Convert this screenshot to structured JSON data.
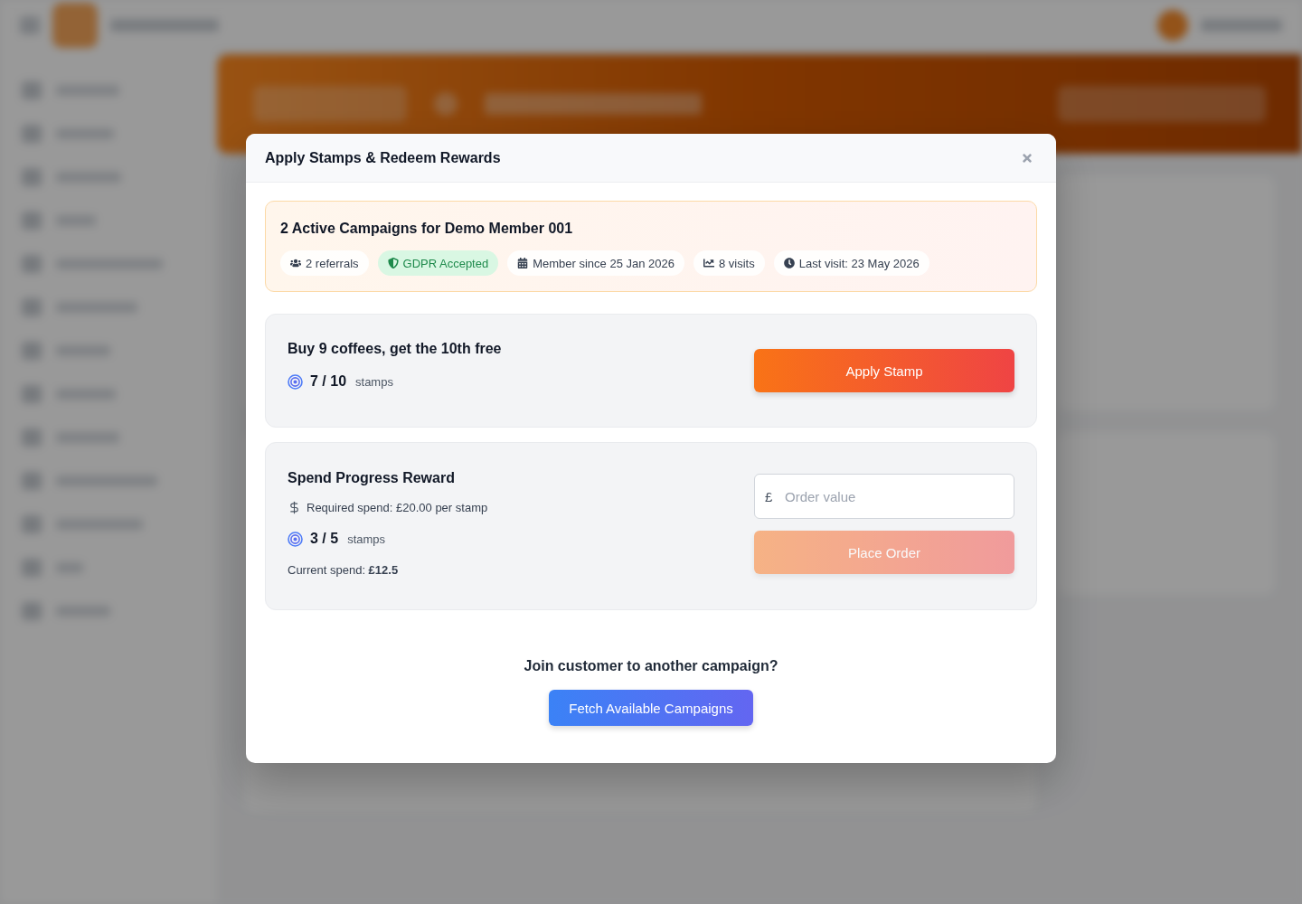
{
  "modal": {
    "title": "Apply Stamps & Redeem Rewards",
    "summary": {
      "title": "2 Active Campaigns for Demo Member 001",
      "chips": [
        {
          "kind": "referrals",
          "label": "2 referrals"
        },
        {
          "kind": "consent",
          "label": "GDPR Accepted"
        },
        {
          "kind": "member_since",
          "label": "Member since 25 Jan 2026"
        },
        {
          "kind": "visits",
          "label": "8 visits"
        },
        {
          "kind": "last_visit",
          "label": "Last visit: 23 May 2026"
        }
      ]
    },
    "campaigns": [
      {
        "kind": "stamp",
        "title": "Buy 9 coffees, get the 10th free",
        "progress": "7 / 10",
        "progress_unit": "stamps",
        "action": {
          "label": "Apply Stamp",
          "disabled": false
        }
      },
      {
        "kind": "spend",
        "title": "Spend Progress Reward",
        "requirement": "Required spend: £20.00 per stamp",
        "progress": "3 / 5",
        "progress_unit": "stamps",
        "current_spend": "Current spend: **£12.5**",
        "order_field": {
          "prefix": "£",
          "placeholder": "Order value"
        },
        "action": {
          "label": "Place Order",
          "disabled": true
        }
      }
    ],
    "join": {
      "prompt": "Join customer to another campaign?",
      "button": "Fetch Available Campaigns"
    }
  }
}
